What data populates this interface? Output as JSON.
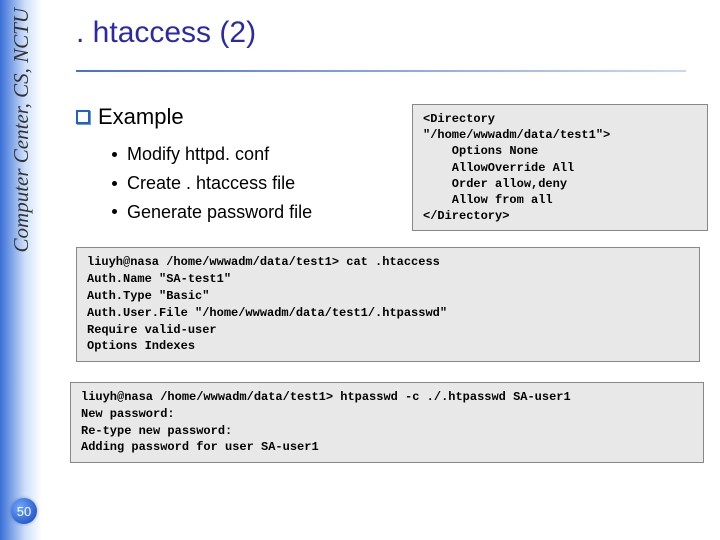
{
  "sidebar": {
    "vertical_label": "Computer Center, CS, NCTU",
    "page_number": "50"
  },
  "slide": {
    "title": ". htaccess (2)",
    "example_heading": "Example",
    "bullets": [
      "Modify httpd. conf",
      "Create . htaccess file",
      "Generate password file"
    ],
    "directory_block": "<Directory\n\"/home/wwwadm/data/test1\">\n    Options None\n    AllowOverride All\n    Order allow,deny\n    Allow from all\n</Directory>",
    "cat_block": {
      "prompt": "liuyh@nasa /home/wwwadm/data/test1>",
      "cmd": " cat .htaccess",
      "body": "Auth.Name \"SA-test1\"\nAuth.Type \"Basic\"\nAuth.User.File \"/home/wwwadm/data/test1/.htpasswd\"\nRequire valid-user\nOptions Indexes"
    },
    "htpasswd_block": {
      "prompt": "liuyh@nasa /home/wwwadm/data/test1>",
      "cmd": " htpasswd -c ./.htpasswd SA-user1",
      "body": "New password:\nRe-type new password:\nAdding password for user SA-user1"
    }
  }
}
